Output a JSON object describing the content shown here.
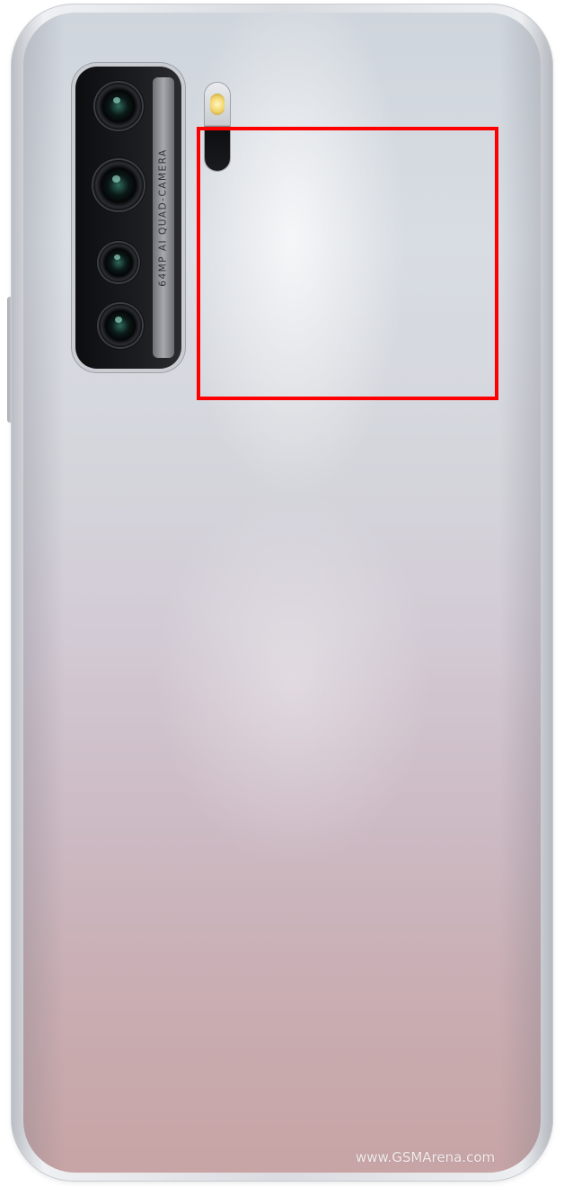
{
  "image": {
    "subject": "smartphone-back",
    "colors": {
      "body_top": "#d8dde3",
      "body_bottom": "#c7a4a5",
      "frame": "#d9dbe0",
      "camera_module": "#1b1d21",
      "highlight": "#ff0000"
    }
  },
  "camera_label": "64MP AI QUAD-CAMERA",
  "watermark": "www.GSMArena.com"
}
